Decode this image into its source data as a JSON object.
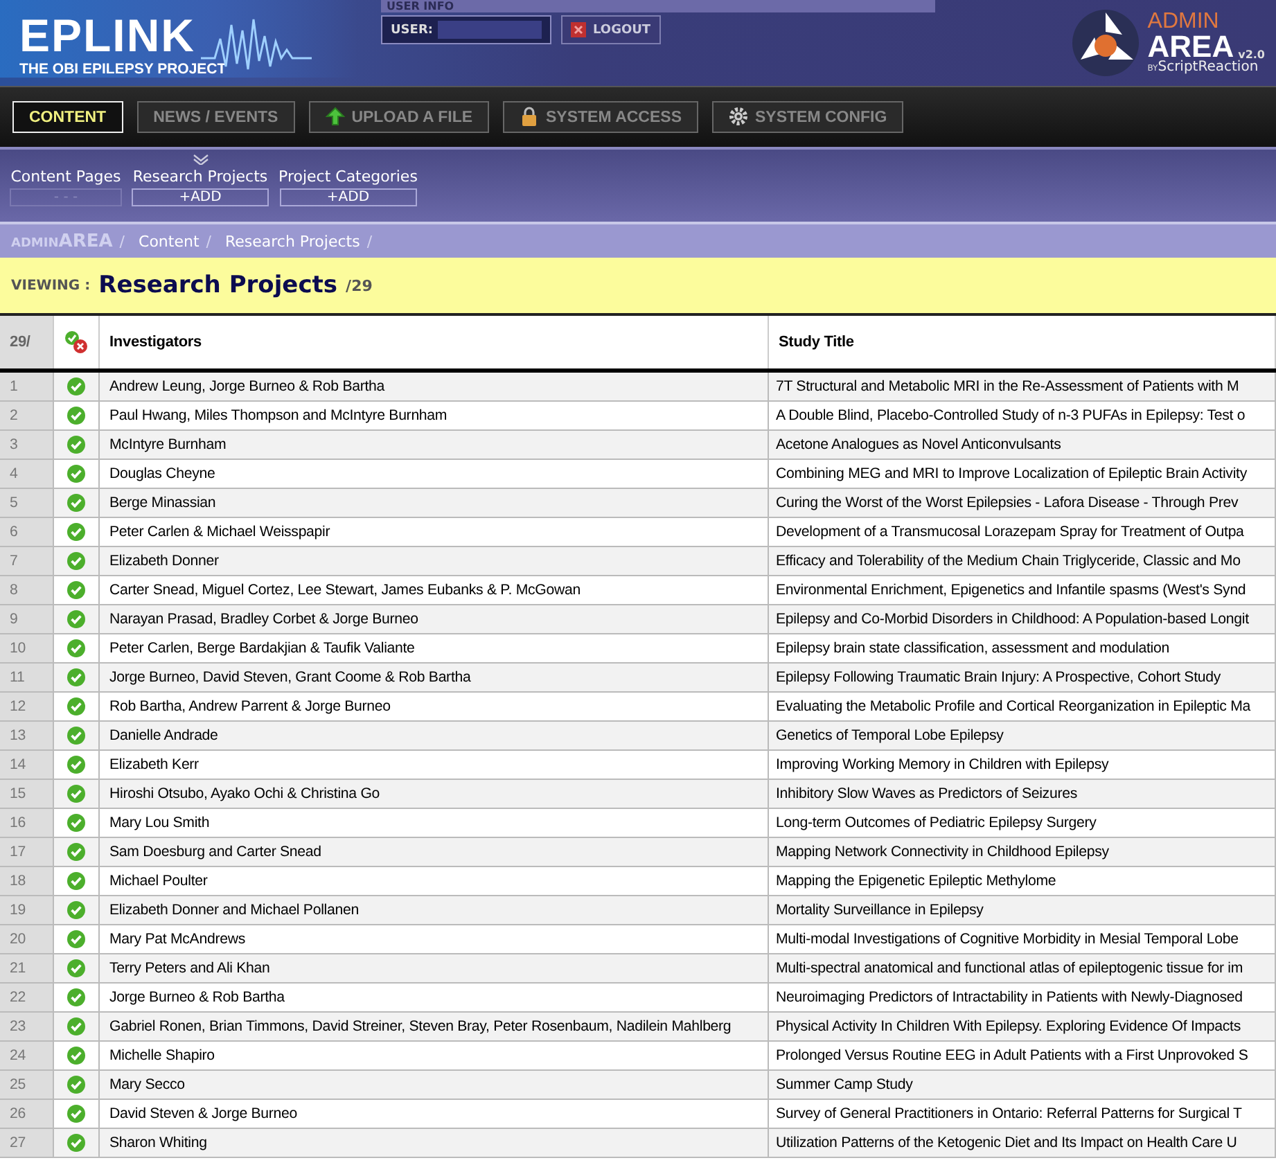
{
  "header": {
    "logo_title": "EPLINK",
    "logo_subtitle": "THE OBI EPILEPSY PROJECT",
    "user_info": {
      "heading": "USER INFO",
      "label": "USER:",
      "logout": "LOGOUT"
    },
    "admin_logo": {
      "line1": "ADMIN",
      "line2": "AREA",
      "version": "v2.0",
      "by": "BY",
      "maker": "ScriptReaction"
    }
  },
  "nav": [
    {
      "label": "CONTENT",
      "kind": "text",
      "selected": true
    },
    {
      "label": "NEWS / EVENTS",
      "kind": "text",
      "selected": false
    },
    {
      "label": "UPLOAD A FILE",
      "kind": "upload",
      "selected": false
    },
    {
      "label": "SYSTEM ACCESS",
      "kind": "lock",
      "selected": false
    },
    {
      "label": "SYSTEM CONFIG",
      "kind": "gear",
      "selected": false
    }
  ],
  "subnav": [
    {
      "label": "Content Pages",
      "action": "- - -",
      "selected": false
    },
    {
      "label": "Research Projects",
      "action": "+ADD",
      "selected": true
    },
    {
      "label": "Project Categories",
      "action": "+ADD",
      "selected": false
    }
  ],
  "breadcrumb": [
    {
      "label": "ADMIN**AREA**",
      "separator": "/"
    },
    {
      "label": "Content",
      "separator": "/"
    },
    {
      "label": "Research Projects",
      "separator": "/"
    }
  ],
  "viewing": {
    "label": "VIEWING :",
    "title": "Research Projects",
    "count": "/29"
  },
  "table": {
    "count": "29/",
    "columns": [
      "Investigators",
      "Study Title"
    ],
    "rows": [
      {
        "num": "1",
        "active": true,
        "investigators": "Andrew Leung, Jorge Burneo & Rob Bartha",
        "title": "7T Structural and Metabolic MRI in the Re-Assessment of Patients with M"
      },
      {
        "num": "2",
        "active": true,
        "investigators": "Paul Hwang, Miles Thompson and McIntyre Burnham",
        "title": "A Double Blind, Placebo-Controlled Study of n-3 PUFAs in Epilepsy: Test o"
      },
      {
        "num": "3",
        "active": true,
        "investigators": "McIntyre Burnham",
        "title": "Acetone Analogues as Novel Anticonvulsants"
      },
      {
        "num": "4",
        "active": true,
        "investigators": "Douglas Cheyne",
        "title": "Combining MEG and MRI to Improve Localization of Epileptic Brain Activity"
      },
      {
        "num": "5",
        "active": true,
        "investigators": "Berge Minassian",
        "title": "Curing the Worst of the Worst Epilepsies - Lafora Disease - Through Prev"
      },
      {
        "num": "6",
        "active": true,
        "investigators": "Peter Carlen & Michael Weisspapir",
        "title": "Development of a Transmucosal Lorazepam Spray for Treatment of Outpa"
      },
      {
        "num": "7",
        "active": true,
        "investigators": "Elizabeth Donner",
        "title": "Efficacy and Tolerability of the Medium Chain Triglyceride, Classic and Mo"
      },
      {
        "num": "8",
        "active": true,
        "investigators": "Carter Snead, Miguel Cortez, Lee Stewart, James Eubanks & P. McGowan",
        "title": "Environmental Enrichment, Epigenetics and Infantile spasms (West's Synd"
      },
      {
        "num": "9",
        "active": true,
        "investigators": "Narayan Prasad, Bradley Corbet & Jorge Burneo",
        "title": "Epilepsy and Co-Morbid Disorders in Childhood: A Population-based Longit"
      },
      {
        "num": "10",
        "active": true,
        "investigators": "Peter Carlen, Berge Bardakjian & Taufik Valiante",
        "title": "Epilepsy brain state classification, assessment and modulation"
      },
      {
        "num": "11",
        "active": true,
        "investigators": "Jorge Burneo, David Steven, Grant Coome & Rob Bartha",
        "title": "Epilepsy Following Traumatic Brain Injury: A Prospective, Cohort Study"
      },
      {
        "num": "12",
        "active": true,
        "investigators": "Rob Bartha, Andrew Parrent & Jorge Burneo",
        "title": "Evaluating the Metabolic Profile and Cortical Reorganization in Epileptic Ma"
      },
      {
        "num": "13",
        "active": true,
        "investigators": "Danielle Andrade",
        "title": "Genetics of Temporal Lobe Epilepsy"
      },
      {
        "num": "14",
        "active": true,
        "investigators": "Elizabeth Kerr",
        "title": "Improving Working Memory in Children with Epilepsy"
      },
      {
        "num": "15",
        "active": true,
        "investigators": "Hiroshi Otsubo, Ayako Ochi & Christina Go",
        "title": "Inhibitory Slow Waves as Predictors of Seizures"
      },
      {
        "num": "16",
        "active": true,
        "investigators": "Mary Lou Smith",
        "title": "Long-term Outcomes of Pediatric Epilepsy Surgery"
      },
      {
        "num": "17",
        "active": true,
        "investigators": "Sam Doesburg and Carter Snead",
        "title": "Mapping Network Connectivity in Childhood Epilepsy"
      },
      {
        "num": "18",
        "active": true,
        "investigators": "Michael Poulter",
        "title": "Mapping the Epigenetic Epileptic Methylome"
      },
      {
        "num": "19",
        "active": true,
        "investigators": "Elizabeth Donner and Michael Pollanen",
        "title": "Mortality Surveillance in Epilepsy"
      },
      {
        "num": "20",
        "active": true,
        "investigators": "Mary Pat McAndrews",
        "title": "Multi-modal Investigations of Cognitive Morbidity in Mesial Temporal Lobe"
      },
      {
        "num": "21",
        "active": true,
        "investigators": "Terry Peters and Ali Khan",
        "title": "Multi-spectral anatomical and functional atlas of epileptogenic tissue for im"
      },
      {
        "num": "22",
        "active": true,
        "investigators": "Jorge Burneo & Rob Bartha",
        "title": "Neuroimaging Predictors of Intractability in Patients with Newly-Diagnosed"
      },
      {
        "num": "23",
        "active": true,
        "investigators": "Gabriel Ronen, Brian Timmons, David Streiner, Steven Bray, Peter Rosenbaum, Nadilein Mahlberg",
        "title": "Physical Activity In Children With Epilepsy. Exploring Evidence Of Impacts"
      },
      {
        "num": "24",
        "active": true,
        "investigators": "Michelle Shapiro",
        "title": "Prolonged Versus Routine EEG in Adult Patients with a First Unprovoked S"
      },
      {
        "num": "25",
        "active": true,
        "investigators": "Mary Secco",
        "title": "Summer Camp Study"
      },
      {
        "num": "26",
        "active": true,
        "investigators": "David Steven & Jorge Burneo",
        "title": "Survey of General Practitioners in Ontario: Referral Patterns for Surgical T"
      },
      {
        "num": "27",
        "active": true,
        "investigators": "Sharon Whiting",
        "title": "Utilization Patterns of the Ketogenic Diet and Its Impact on Health Care U"
      }
    ]
  }
}
